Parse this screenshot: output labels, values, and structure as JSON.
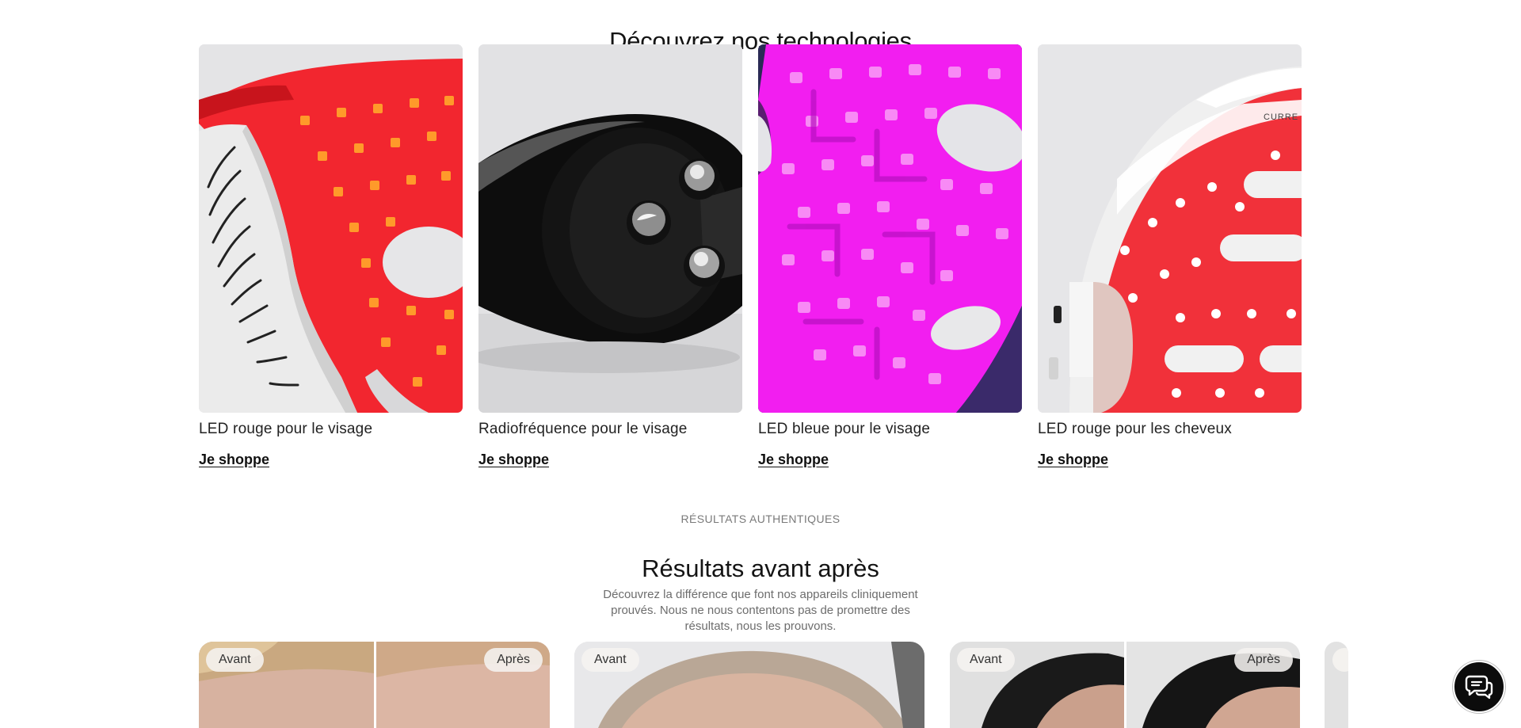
{
  "technologies": {
    "title": "Découvrez nos technologies",
    "cards": [
      {
        "label": "LED rouge pour le visage",
        "cta": "Je shoppe",
        "image": "red-led-face-mask"
      },
      {
        "label": "Radiofréquence pour le visage",
        "cta": "Je shoppe",
        "image": "radiofrequency-device"
      },
      {
        "label": "LED bleue pour le visage",
        "cta": "Je shoppe",
        "image": "pink-led-face-mask"
      },
      {
        "label": "LED rouge pour les cheveux",
        "cta": "Je shoppe",
        "image": "red-led-hair-helmet"
      }
    ]
  },
  "results": {
    "eyebrow": "RÉSULTATS AUTHENTIQUES",
    "title": "Résultats avant après",
    "description": "Découvrez la différence que font nos appareils cliniquement prouvés. Nous ne nous contentons pas de promettre des résultats, nous les prouvons.",
    "before_label": "Avant",
    "after_label": "Après"
  },
  "chat": {
    "icon": "chat-icon"
  },
  "colors": {
    "led_red": "#f2262f",
    "led_pink": "#f21ef0",
    "text": "#141414",
    "muted": "#7a7a7a"
  }
}
